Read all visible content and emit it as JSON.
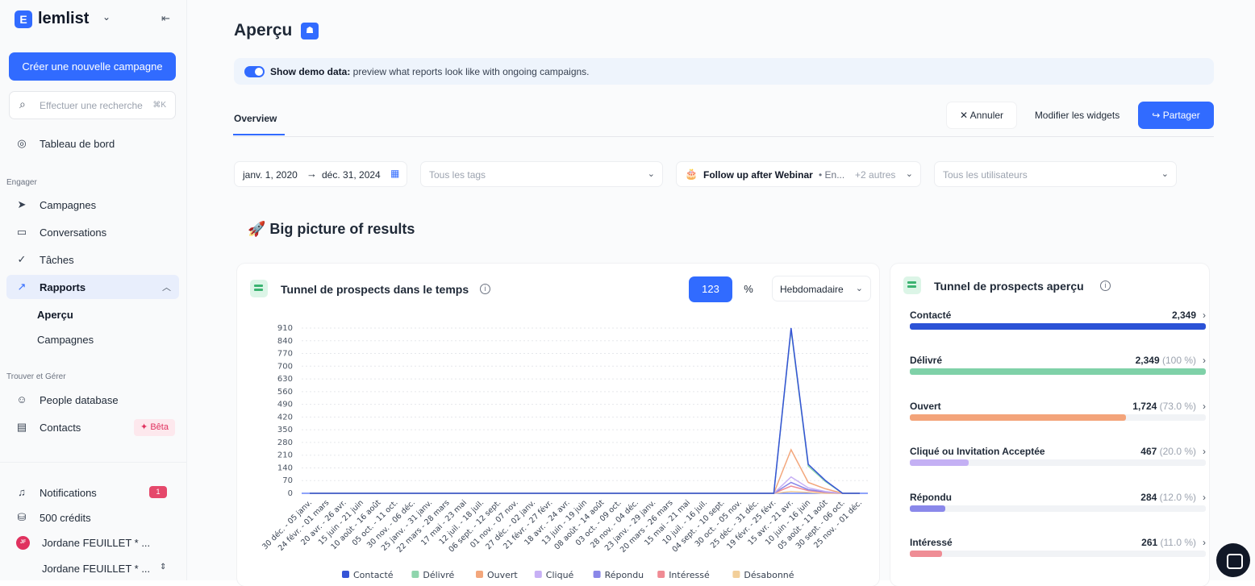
{
  "app": {
    "logo_letter": "E",
    "logo": "lemlist"
  },
  "sidebar": {
    "new_campaign": "Créer une nouvelle campagne",
    "search_placeholder": "Effectuer une recherche",
    "search_shortcut": "⌘K",
    "dashboard": "Tableau de bord",
    "section_engage": "Engager",
    "campaigns": "Campagnes",
    "conversations": "Conversations",
    "tasks": "Tâches",
    "reports": "Rapports",
    "reports_sub": [
      "Aperçu",
      "Campagnes"
    ],
    "section_find": "Trouver et Gérer",
    "people_db": "People database",
    "contacts": "Contacts",
    "beta": "Bêta",
    "notifications": "Notifications",
    "notifications_count": "1",
    "credits": "500 crédits",
    "user1": "Jordane FEUILLET * ...",
    "user1_initials": "JF",
    "user2": "Jordane FEUILLET * ..."
  },
  "header": {
    "title": "Aperçu",
    "title_badge": "☗",
    "demo_bold": "Show demo data:",
    "demo_text": " preview what reports look like with ongoing campaigns.",
    "tab": "Overview",
    "cancel": "Annuler",
    "edit_widgets": "Modifier les widgets",
    "share": "Partager"
  },
  "filters": {
    "date_from": "janv. 1, 2020",
    "date_to": "déc. 31, 2024",
    "tags_placeholder": "Tous les tags",
    "campaign": "Follow up after Webinar",
    "campaign_more": "• En...",
    "campaign_others": "+2 autres",
    "users_placeholder": "Tous les utilisateurs"
  },
  "section_title": "🚀 Big picture of results",
  "chart_card": {
    "title": "Tunnel de prospects dans le temps",
    "mode_number": "123",
    "mode_percent": "%",
    "period": "Hebdomadaire"
  },
  "chart_data": {
    "type": "line",
    "yticks": [
      0,
      70,
      140,
      210,
      280,
      350,
      420,
      490,
      560,
      630,
      700,
      770,
      840,
      910
    ],
    "ylim": [
      0,
      910
    ],
    "categories": [
      "30 déc. - 05 janv.",
      "24 févr. - 01 mars",
      "20 avr. - 26 avr.",
      "15 juin - 21 juin",
      "10 août - 16 août",
      "05 oct. - 11 oct.",
      "30 nov. - 06 déc.",
      "25 janv. - 31 janv.",
      "22 mars - 28 mars",
      "17 mai - 23 mai",
      "12 juil. - 18 juil.",
      "06 sept. - 12 sept.",
      "01 nov. - 07 nov.",
      "27 déc. - 02 janv.",
      "21 févr. - 27 févr.",
      "18 avr. - 24 avr.",
      "13 juin - 19 juin",
      "08 août - 14 août",
      "03 oct. - 09 oct.",
      "28 nov. - 04 déc.",
      "23 janv. - 29 janv.",
      "20 mars - 26 mars",
      "15 mai - 21 mai",
      "10 juil. - 16 juil.",
      "04 sept. - 10 sept.",
      "30 oct. - 05 nov.",
      "25 déc. - 31 déc.",
      "19 févr. - 25 févr.",
      "15 avr. - 21 avr.",
      "10 juin - 16 juin",
      "05 août - 11 août",
      "30 sept. - 06 oct.",
      "25 nov. - 01 déc."
    ],
    "series": [
      {
        "name": "Contacté",
        "color": "#3654d6",
        "values": [
          0,
          0,
          0,
          0,
          0,
          0,
          0,
          0,
          0,
          0,
          0,
          0,
          0,
          0,
          0,
          0,
          0,
          0,
          0,
          0,
          0,
          0,
          0,
          0,
          0,
          0,
          0,
          0,
          930,
          160,
          70,
          0,
          0
        ]
      },
      {
        "name": "Délivré",
        "color": "#8fd5ad",
        "values": [
          0,
          0,
          0,
          0,
          0,
          0,
          0,
          0,
          0,
          0,
          0,
          0,
          0,
          0,
          0,
          0,
          0,
          0,
          0,
          0,
          0,
          0,
          0,
          0,
          0,
          0,
          0,
          0,
          900,
          150,
          65,
          0,
          0
        ]
      },
      {
        "name": "Ouvert",
        "color": "#f3a77c",
        "values": [
          0,
          0,
          0,
          0,
          0,
          0,
          0,
          0,
          0,
          0,
          0,
          0,
          0,
          0,
          0,
          0,
          0,
          0,
          0,
          0,
          0,
          0,
          0,
          0,
          0,
          0,
          0,
          0,
          240,
          60,
          25,
          0,
          0
        ]
      },
      {
        "name": "Cliqué",
        "color": "#c7b0f5",
        "values": [
          0,
          0,
          0,
          0,
          0,
          0,
          0,
          0,
          0,
          0,
          0,
          0,
          0,
          0,
          0,
          0,
          0,
          0,
          0,
          0,
          0,
          0,
          0,
          0,
          0,
          0,
          0,
          0,
          90,
          30,
          10,
          0,
          0
        ]
      },
      {
        "name": "Répondu",
        "color": "#8a87e8",
        "values": [
          0,
          0,
          0,
          0,
          0,
          0,
          0,
          0,
          0,
          0,
          0,
          0,
          0,
          0,
          0,
          0,
          0,
          0,
          0,
          0,
          0,
          0,
          0,
          0,
          0,
          0,
          0,
          0,
          60,
          20,
          8,
          0,
          0
        ]
      },
      {
        "name": "Intéressé",
        "color": "#f08b94",
        "values": [
          0,
          0,
          0,
          0,
          0,
          0,
          0,
          0,
          0,
          0,
          0,
          0,
          0,
          0,
          0,
          0,
          0,
          0,
          0,
          0,
          0,
          0,
          0,
          0,
          0,
          0,
          0,
          0,
          40,
          15,
          5,
          0,
          0
        ]
      },
      {
        "name": "Désabonné",
        "color": "#f2cf9a",
        "values": [
          0,
          0,
          0,
          0,
          0,
          0,
          0,
          0,
          0,
          0,
          0,
          0,
          0,
          0,
          0,
          0,
          0,
          0,
          0,
          0,
          0,
          0,
          0,
          0,
          0,
          0,
          0,
          0,
          10,
          5,
          0,
          0,
          0
        ]
      }
    ],
    "grid": true,
    "legend_position": "bottom"
  },
  "funnel_card": {
    "title": "Tunnel de prospects aperçu",
    "rows": [
      {
        "name": "Contacté",
        "value": "2,349",
        "pct": "",
        "fill": 1.0,
        "color": "#2b52d6"
      },
      {
        "name": "Délivré",
        "value": "2,349",
        "pct": "(100 %)",
        "fill": 1.0,
        "color": "#7fd1a8"
      },
      {
        "name": "Ouvert",
        "value": "1,724",
        "pct": "(73.0 %)",
        "fill": 0.73,
        "color": "#f3a47a"
      },
      {
        "name": "Cliqué ou Invitation Acceptée",
        "value": "467",
        "pct": "(20.0 %)",
        "fill": 0.2,
        "color": "#c4b0f4"
      },
      {
        "name": "Répondu",
        "value": "284",
        "pct": "(12.0 %)",
        "fill": 0.12,
        "color": "#8a88ea"
      },
      {
        "name": "Intéressé",
        "value": "261",
        "pct": "(11.0 %)",
        "fill": 0.11,
        "color": "#ef8d95"
      }
    ]
  }
}
